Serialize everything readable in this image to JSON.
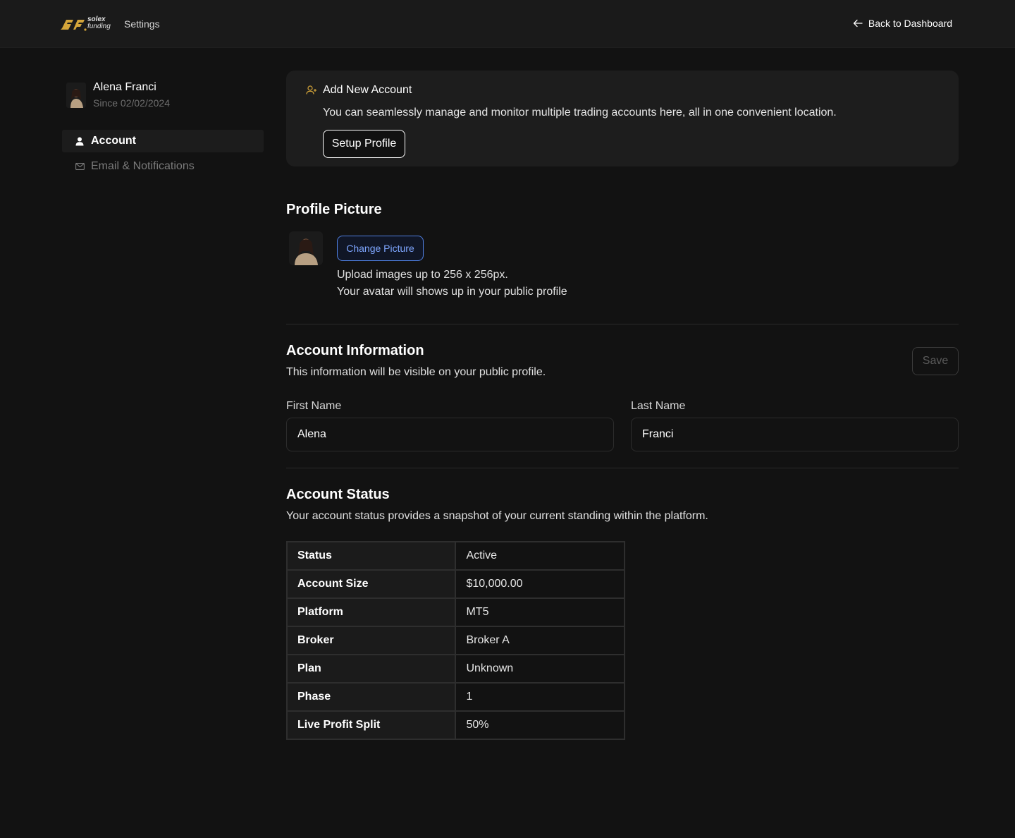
{
  "header": {
    "logo_top": "solex",
    "logo_bottom": "funding",
    "title": "Settings",
    "back_label": "Back to Dashboard"
  },
  "sidebar": {
    "user_name": "Alena Franci",
    "user_since": "Since 02/02/2024",
    "items": [
      {
        "label": "Account",
        "icon": "user-icon",
        "active": true
      },
      {
        "label": "Email & Notifications",
        "icon": "mail-icon",
        "active": false
      }
    ]
  },
  "add_account": {
    "title": "Add New Account",
    "description": "You can seamlessly manage and monitor multiple trading accounts here, all in one convenient location.",
    "button": "Setup Profile"
  },
  "profile_picture": {
    "title": "Profile Picture",
    "button": "Change Picture",
    "hint1": "Upload images up to 256 x 256px.",
    "hint2": "Your avatar will shows up in your public profile"
  },
  "account_info": {
    "title": "Account Information",
    "description": "This information will be visible on your public profile.",
    "save_label": "Save",
    "first_name_label": "First Name",
    "first_name_value": "Alena",
    "last_name_label": "Last Name",
    "last_name_value": "Franci"
  },
  "account_status": {
    "title": "Account Status",
    "description": "Your account status provides a snapshot of your current standing within the platform.",
    "rows": [
      {
        "key": "Status",
        "value": "Active"
      },
      {
        "key": "Account Size",
        "value": "$10,000.00"
      },
      {
        "key": "Platform",
        "value": "MT5"
      },
      {
        "key": "Broker",
        "value": "Broker A"
      },
      {
        "key": "Plan",
        "value": "Unknown"
      },
      {
        "key": "Phase",
        "value": "1"
      },
      {
        "key": "Live Profit Split",
        "value": "50%"
      }
    ]
  },
  "colors": {
    "brand_gold": "#d4a53a",
    "accent_blue": "#4f7fe0",
    "background": "#121212"
  }
}
